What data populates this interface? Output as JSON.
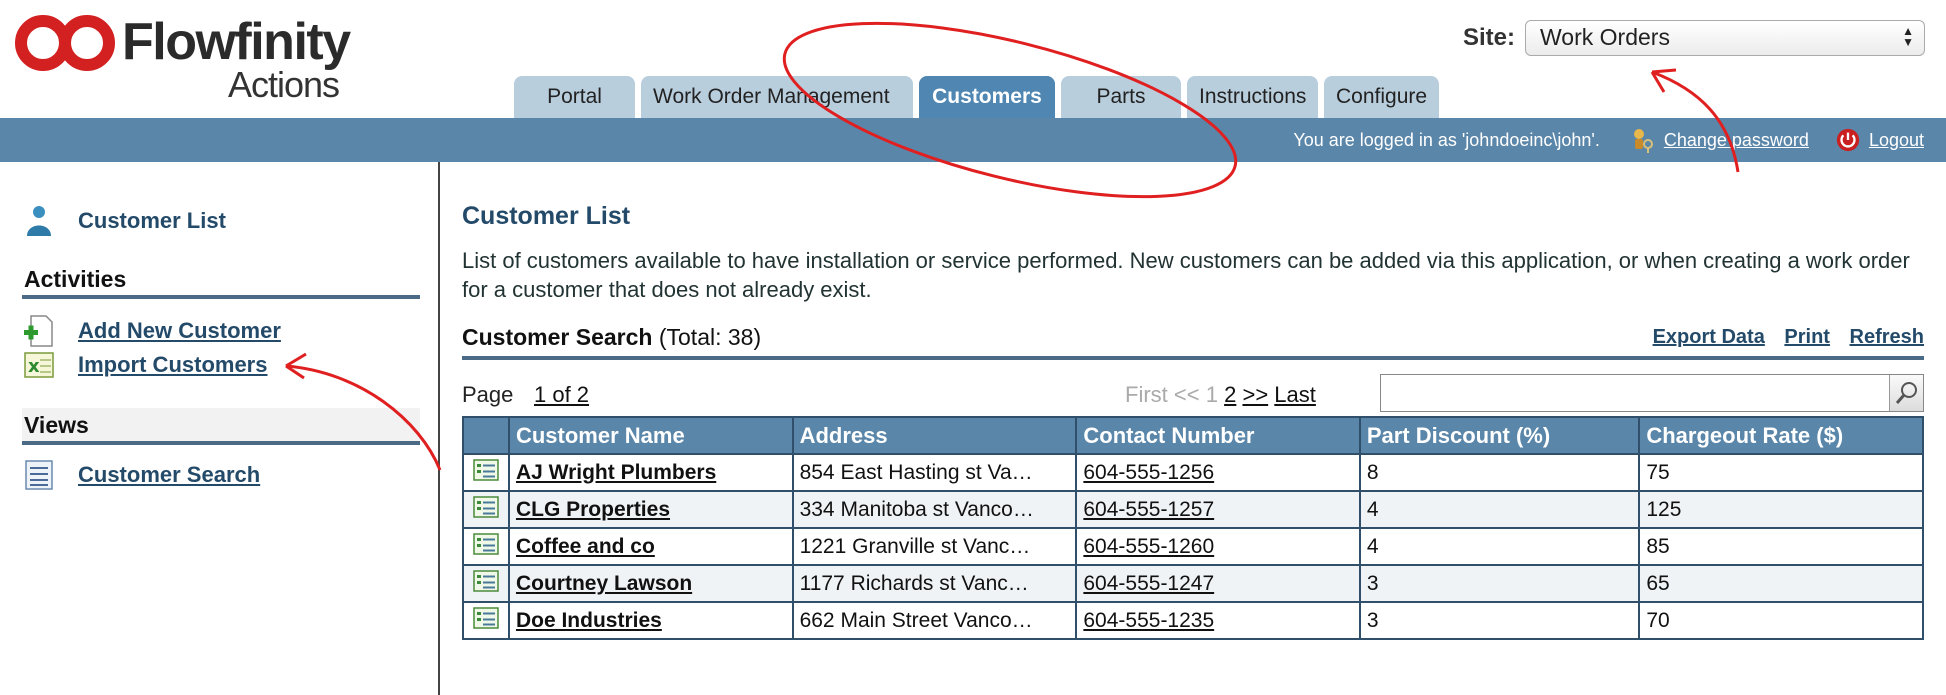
{
  "brand": {
    "name": "Flowfinity",
    "sub": "Actions"
  },
  "site": {
    "label": "Site:",
    "value": "Work Orders"
  },
  "tabs": [
    {
      "label": "Portal"
    },
    {
      "label": "Work Order Management"
    },
    {
      "label": "Customers"
    },
    {
      "label": "Parts"
    },
    {
      "label": "Instructions"
    },
    {
      "label": "Configure"
    }
  ],
  "userbar": {
    "logged_in": "You are logged in as 'johndoeinc\\john'.",
    "change_password": "Change password",
    "logout": "Logout"
  },
  "sidebar": {
    "customer_list": "Customer List",
    "activities_heading": "Activities",
    "add_new_customer": "Add New Customer",
    "import_customers": "Import Customers",
    "views_heading": "Views",
    "customer_search": "Customer Search"
  },
  "main": {
    "title": "Customer List",
    "description": "List of customers available to have installation or service performed. New customers can be added via this application, or when creating a work order for a customer that does not already exist.",
    "search_title": "Customer Search",
    "search_total": "(Total: 38)",
    "actions": {
      "export": "Export Data",
      "print": "Print",
      "refresh": "Refresh"
    },
    "pager": {
      "label": "Page",
      "value": "1 of 2",
      "first": "First",
      "prev": "<<",
      "page1": "1",
      "page2": "2",
      "next": ">>",
      "last": "Last"
    },
    "columns": [
      "Customer Name",
      "Address",
      "Contact Number",
      "Part Discount (%)",
      "Chargeout Rate ($)"
    ],
    "rows": [
      {
        "name": "AJ Wright Plumbers",
        "address": "854 East Hasting st Va…",
        "phone": "604-555-1256",
        "discount": "8",
        "rate": "75"
      },
      {
        "name": "CLG Properties",
        "address": "334 Manitoba st Vanco…",
        "phone": "604-555-1257",
        "discount": "4",
        "rate": "125"
      },
      {
        "name": "Coffee and co",
        "address": "1221 Granville st Vanc…",
        "phone": "604-555-1260",
        "discount": "4",
        "rate": "85"
      },
      {
        "name": "Courtney Lawson",
        "address": "1177 Richards st Vanc…",
        "phone": "604-555-1247",
        "discount": "3",
        "rate": "65"
      },
      {
        "name": "Doe Industries",
        "address": "662 Main Street Vanco…",
        "phone": "604-555-1235",
        "discount": "3",
        "rate": "70"
      }
    ]
  },
  "colors": {
    "header_bar": "#5a86a9",
    "tab_active": "#4f86b2",
    "tab_inactive": "#b9cedd",
    "annotation": "#e02020",
    "logo_red": "#d32020"
  }
}
